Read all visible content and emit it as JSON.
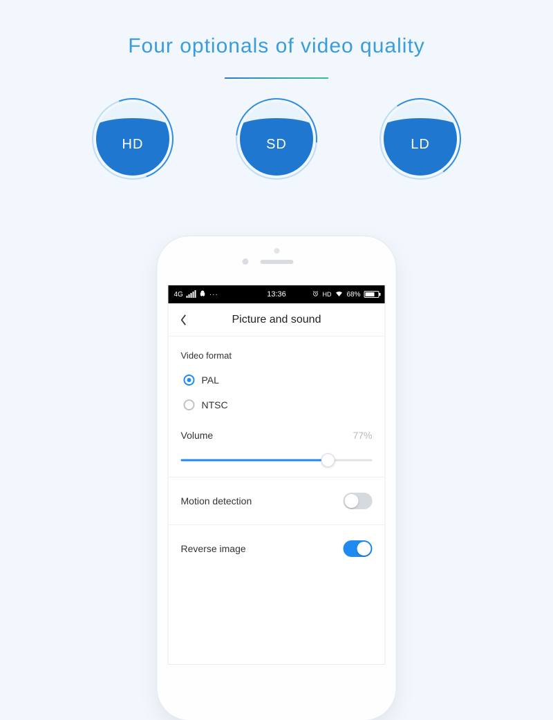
{
  "banner": {
    "title": "Four optionals of  video quality",
    "bubbles": [
      "HD",
      "SD",
      "LD"
    ]
  },
  "phone": {
    "statusbar": {
      "network": "4G",
      "time": "13:36",
      "hd": "HD",
      "battery_pct": "68%"
    },
    "nav": {
      "title": "Picture and sound"
    },
    "settings": {
      "video_format_label": "Video format",
      "radios": {
        "pal": "PAL",
        "ntsc": "NTSC",
        "selected": "pal"
      },
      "volume_label": "Volume",
      "volume_value": "77%",
      "volume_pct": 77,
      "motion_label": "Motion detection",
      "motion_on": false,
      "reverse_label": "Reverse image",
      "reverse_on": true
    }
  }
}
